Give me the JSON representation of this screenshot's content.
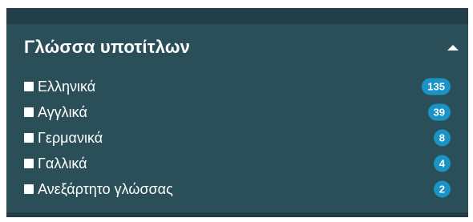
{
  "filter": {
    "title": "Γλώσσα υποτίτλων",
    "collapse_icon": "chevron-up-icon",
    "options": [
      {
        "label": "Ελληνικά",
        "count": "135",
        "checked": false
      },
      {
        "label": "Αγγλικά",
        "count": "39",
        "checked": false
      },
      {
        "label": "Γερμανικά",
        "count": "8",
        "checked": false
      },
      {
        "label": "Γαλλικά",
        "count": "4",
        "checked": false
      },
      {
        "label": "Ανεξάρτητο γλώσσας",
        "count": "2",
        "checked": false
      }
    ]
  },
  "colors": {
    "panel_background": "#2b4f58",
    "panel_border": "#223f47",
    "badge": "#1a93c7",
    "text": "#ffffff"
  }
}
